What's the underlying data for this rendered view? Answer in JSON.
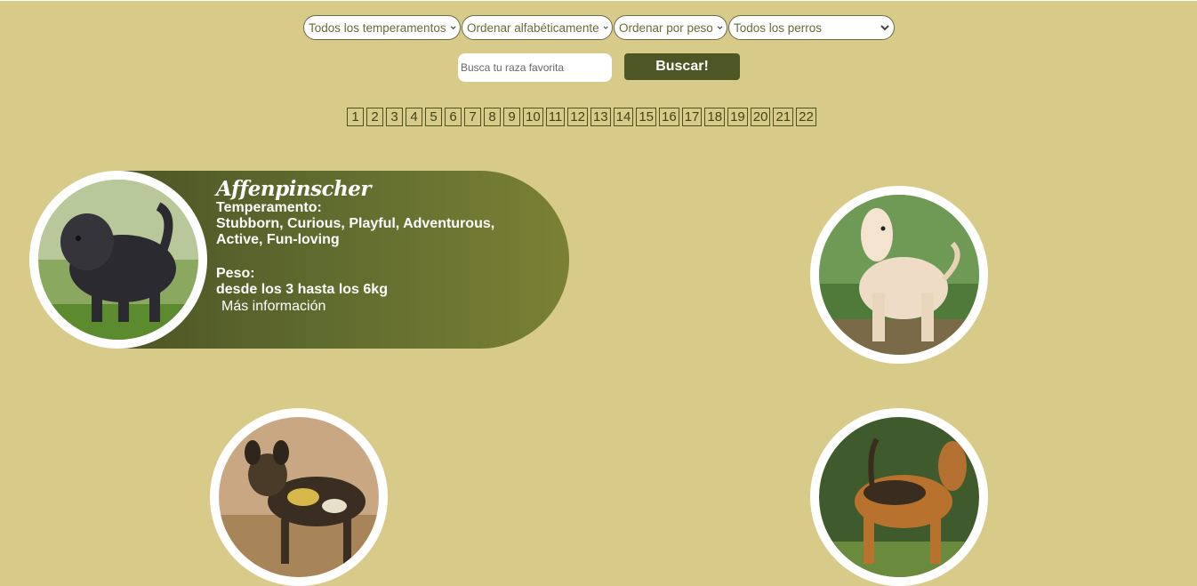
{
  "filters": {
    "temperaments": "Todos los temperamentos",
    "alphabetical": "Ordenar alfabéticamente",
    "weight": "Ordenar por peso",
    "dogs": "Todos los perros"
  },
  "search": {
    "placeholder": "Busca tu raza favorita",
    "button_label": "Buscar!"
  },
  "pagination": [
    "1",
    "2",
    "3",
    "4",
    "5",
    "6",
    "7",
    "8",
    "9",
    "10",
    "11",
    "12",
    "13",
    "14",
    "15",
    "16",
    "17",
    "18",
    "19",
    "20",
    "21",
    "22"
  ],
  "featured_card": {
    "name": "Affenpinscher",
    "temperament_label": "Temperamento:",
    "temperament": "Stubborn, Curious, Playful, Adventurous, Active, Fun-loving",
    "weight_label": "Peso:",
    "weight": "desde los 3 hasta los 6kg",
    "more_link": "Más información"
  },
  "dog_images": [
    "affenpinscher-photo",
    "afghan-hound-photo",
    "african-wild-dog-photo",
    "airedale-terrier-photo"
  ],
  "colors": {
    "background": "#d8cb89",
    "button": "#4f5625",
    "card_gradient_start": "#4d5525",
    "card_gradient_end": "#7a8135"
  }
}
